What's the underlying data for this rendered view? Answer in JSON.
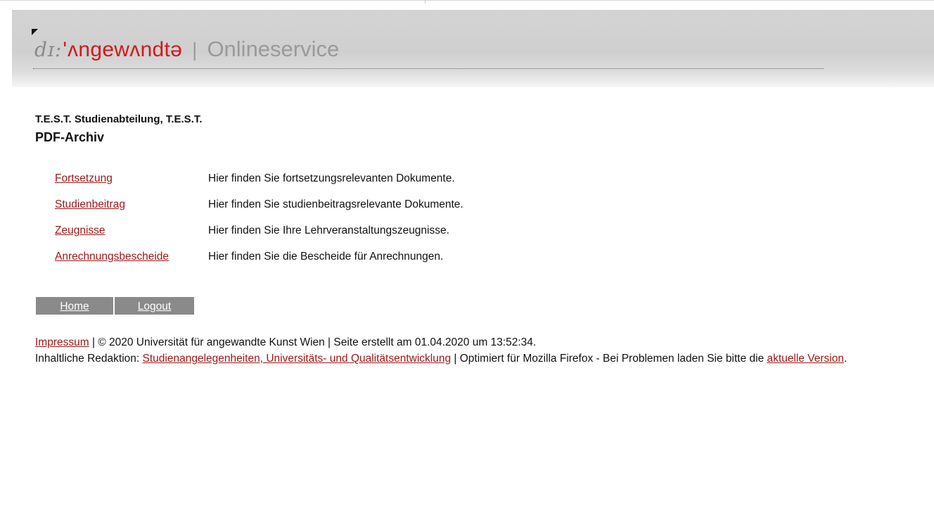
{
  "header": {
    "logo_ipa": "dɪ:",
    "logo_apostrophe": "'",
    "logo_brand": "ʌngewʌndtə",
    "separator": "|",
    "service": "Onlineservice"
  },
  "org_line": "T.E.S.T. Studienabteilung, T.E.S.T.",
  "page_title": "PDF-Archiv",
  "archive_items": [
    {
      "label": "Fortsetzung",
      "description": "Hier finden Sie fortsetzungsrelevanten Dokumente."
    },
    {
      "label": "Studienbeitrag",
      "description": "Hier finden Sie studienbeitragsrelevante Dokumente."
    },
    {
      "label": "Zeugnisse",
      "description": "Hier finden Sie Ihre Lehrveranstaltungszeugnisse."
    },
    {
      "label": "Anrechnungsbescheide",
      "description": "Hier finden Sie die Bescheide für Anrechnungen."
    }
  ],
  "nav": {
    "home": "Home",
    "logout": "Logout"
  },
  "footer": {
    "impressum": "Impressum",
    "line1_rest": " | © 2020 Universität für angewandte Kunst Wien | Seite erstellt am 01.04.2020 um 13:52:34.",
    "line2_prefix": "Inhaltliche Redaktion: ",
    "redaktion_link": "Studienangelegenheiten, Universitäts- und Qualitätsentwicklung",
    "line2_middle": " | Optimiert für Mozilla Firefox - Bei Problemen laden Sie bitte die ",
    "version_link": "aktuelle Version",
    "line2_end": "."
  },
  "colors": {
    "link": "#a01818",
    "brand_red": "#d11a1a",
    "header_gray": "#d7d7d7",
    "nav_gray": "#8a8a8a"
  }
}
